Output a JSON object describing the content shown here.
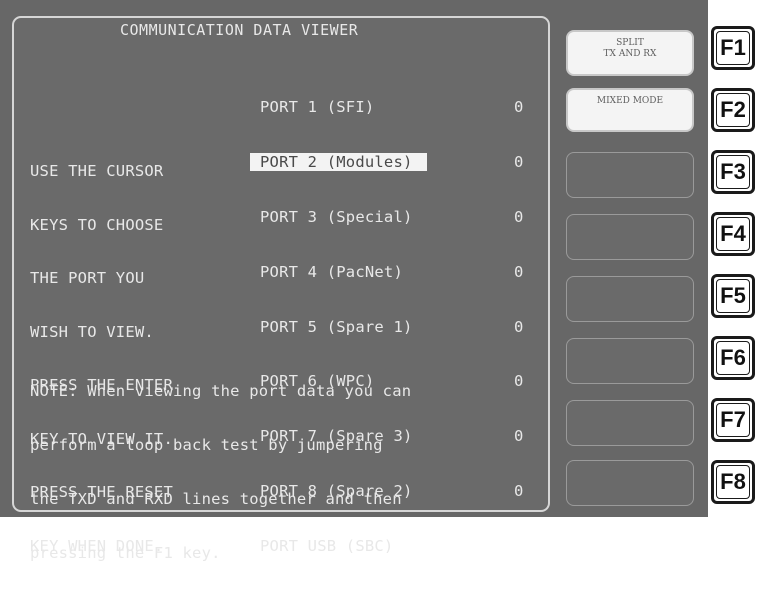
{
  "title": "COMMUNICATION DATA VIEWER",
  "instructions": [
    "USE THE CURSOR",
    "KEYS TO CHOOSE",
    "THE PORT YOU",
    "WISH TO VIEW.",
    "PRESS THE ENTER",
    "KEY TO VIEW IT.",
    "PRESS THE RESET",
    "KEY WHEN DONE."
  ],
  "ports": [
    {
      "label": "PORT 1 (SFI)",
      "count": "0"
    },
    {
      "label": "PORT 2 (Modules)",
      "count": "0",
      "selected": true
    },
    {
      "label": "PORT 3 (Special)",
      "count": "0"
    },
    {
      "label": "PORT 4 (PacNet)",
      "count": "0"
    },
    {
      "label": "PORT 5 (Spare 1)",
      "count": "0"
    },
    {
      "label": "PORT 6 (WPC)",
      "count": "0"
    },
    {
      "label": "PORT 7 (Spare 3)",
      "count": "0"
    },
    {
      "label": "PORT 8 (Spare 2)",
      "count": "0"
    },
    {
      "label": "PORT USB (SBC)",
      "count": ""
    }
  ],
  "note": [
    "NOTE: When viewing the port data you can",
    "perform a loop back test by jumpering",
    "the TXD and RXD lines together and then",
    "pressing the F1 key."
  ],
  "softkeys": [
    {
      "label": "SPLIT\nTX AND RX",
      "active": true
    },
    {
      "label": "MIXED MODE",
      "active": true
    },
    {
      "label": "",
      "active": false
    },
    {
      "label": "",
      "active": false
    },
    {
      "label": "",
      "active": false
    },
    {
      "label": "",
      "active": false
    },
    {
      "label": "",
      "active": false
    },
    {
      "label": "",
      "active": false
    }
  ],
  "function_keys": [
    "F1",
    "F2",
    "F3",
    "F4",
    "F5",
    "F6",
    "F7",
    "F8"
  ]
}
